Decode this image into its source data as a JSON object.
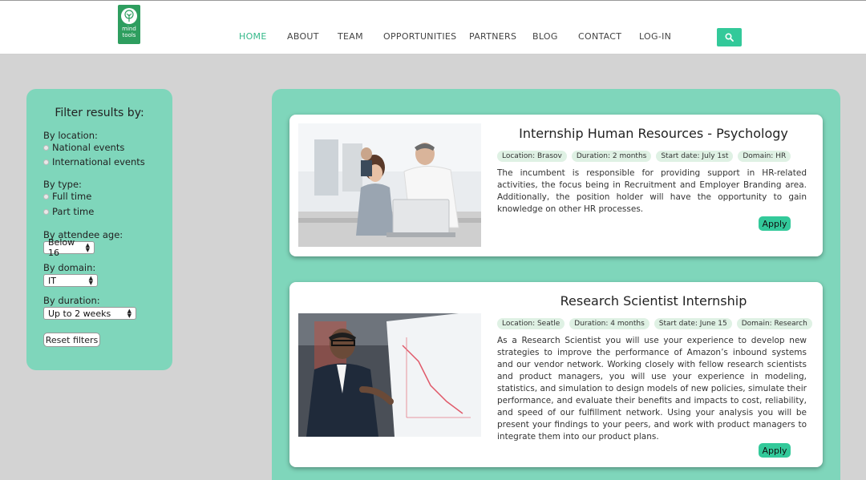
{
  "header": {
    "logo_text_1": "mind",
    "logo_text_2": "tools",
    "nav": [
      {
        "label": "HOME"
      },
      {
        "label": "ABOUT"
      },
      {
        "label": "TEAM"
      },
      {
        "label": "OPPORTUNITIES"
      },
      {
        "label": "PARTNERS"
      },
      {
        "label": "BLOG"
      },
      {
        "label": "CONTACT"
      },
      {
        "label": "LOG-IN"
      }
    ],
    "active_nav": "HOME",
    "search_icon": "search-icon"
  },
  "filter": {
    "title": "Filter results by:",
    "location_label": "By location:",
    "location_options": [
      "National events",
      "International events"
    ],
    "type_label": "By type:",
    "type_options": [
      "Full time",
      "Part time"
    ],
    "age_label": "By attendee age:",
    "age_value": "Below 16",
    "domain_label": "By domain:",
    "domain_value": "IT",
    "duration_label": "By duration:",
    "duration_value": "Up to 2 weeks",
    "reset_label": "Reset filters"
  },
  "listings": [
    {
      "title": "Internship Human Resources - Psychology",
      "tags": [
        "Location: Brasov",
        "Duration: 2 months",
        "Start date: July 1st",
        "Domain: HR"
      ],
      "description": "The incumbent is responsible for providing support in HR-related activities, the focus being in Recruitment and Employer Branding area. Additionally, the position holder will have the opportunity to gain knowledge on other HR processes.",
      "apply_label": "Apply"
    },
    {
      "title": "Research Scientist Internship",
      "tags": [
        "Location: Seatle",
        "Duration: 4 months",
        "Start date: June 15",
        "Domain: Research"
      ],
      "description": "As a Research Scientist you will use your experience to develop new strategies to improve the performance of Amazon’s inbound systems and our vendor network. Working closely with fellow research scientists and product managers, you will use your experience in modeling, statistics, and simulation to design models of new policies, simulate their performance, and evaluate their benefits and impacts to cost, reliability, and speed of our fulfillment network. Using your analysis you will be present your findings to your peers, and work with product managers to integrate them into our product plans.",
      "apply_label": "Apply"
    }
  ],
  "colors": {
    "accent": "#33c99a",
    "panel": "#7fd6bb",
    "background": "#d3d3d3",
    "tag_bg": "#dff1e4",
    "logo_green": "#2e9e5f"
  }
}
